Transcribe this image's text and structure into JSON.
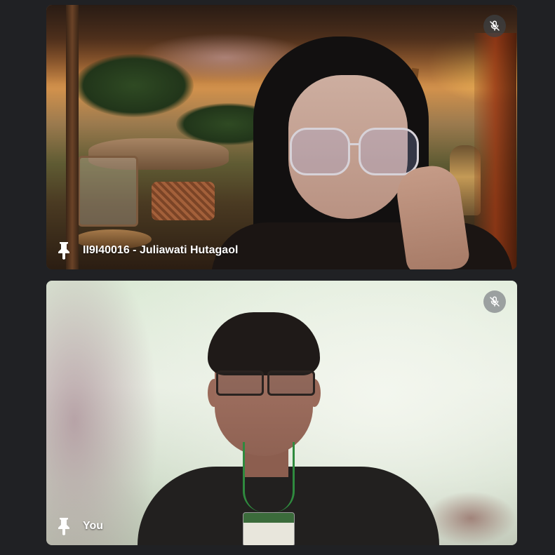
{
  "meeting": {
    "tiles": [
      {
        "participant_name": "II9I40016 - Juliawati Hutagaol",
        "muted": true,
        "mic_icon": "mic-off-icon",
        "pin_icon": "pin-icon"
      },
      {
        "participant_name": "You",
        "muted": true,
        "mic_icon": "mic-off-icon",
        "pin_icon": "pin-icon"
      }
    ]
  },
  "colors": {
    "background": "#202124",
    "label_text": "#ffffff",
    "mute_bg": "#3c4043"
  }
}
